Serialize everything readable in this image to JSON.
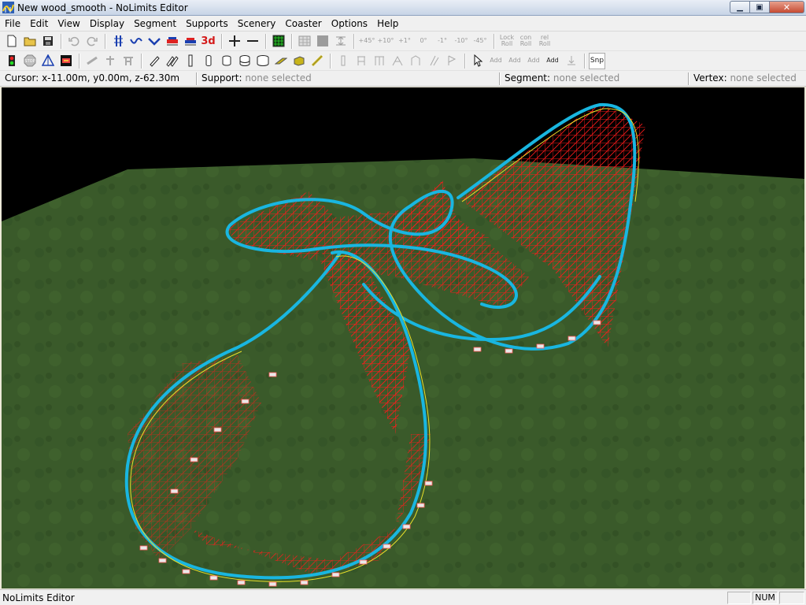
{
  "window": {
    "title": "New wood_smooth - NoLimits Editor",
    "min_glyph": "▁",
    "max_glyph": "▣",
    "close_glyph": "✕"
  },
  "menu": [
    "File",
    "Edit",
    "View",
    "Display",
    "Segment",
    "Supports",
    "Scenery",
    "Coaster",
    "Options",
    "Help"
  ],
  "toolbar1": {
    "icons": [
      "new-file-icon",
      "open-folder-icon",
      "save-disk-icon",
      "undo-icon",
      "redo-icon",
      "track-grid-icon",
      "segment-curve-icon",
      "segment-bend-icon",
      "train-icon",
      "train-alt-icon",
      "view-3d-icon",
      "zoom-in-icon",
      "zoom-out-icon",
      "terrain-map-icon",
      "grid-view-icon",
      "solid-view-icon",
      "align-icon"
    ],
    "text_3d": "3d",
    "roll_buttons": [
      "+45°",
      "+10°",
      "+1°",
      "0°",
      "-1°",
      "-10°",
      "-45°"
    ],
    "lock_roll": [
      "Lock",
      "Roll"
    ],
    "con_roll": [
      "con",
      "Roll"
    ],
    "rel_roll": [
      "rel",
      "Roll"
    ]
  },
  "toolbar2": {
    "icons": [
      "signal-light-icon",
      "stop-sign-icon",
      "station-icon",
      "block-brake-icon",
      "support-beam-icon",
      "support-post-icon",
      "support-tower-icon",
      "pencil-icon",
      "double-pencil-icon",
      "rail-piece-icon",
      "cylinder-1-icon",
      "cylinder-2-icon",
      "cylinder-3-icon",
      "cylinder-4-icon",
      "plank-icon",
      "box-icon",
      "ruler-icon",
      "footer-1-icon",
      "footer-2-icon",
      "footer-3-icon",
      "footer-4-icon",
      "footer-5-icon",
      "footer-6-icon",
      "footer-7-icon",
      "select-arrow-icon"
    ],
    "add_buttons": [
      "Add",
      "Add",
      "Add",
      "Add"
    ],
    "snap_label": "Snp"
  },
  "info": {
    "cursor_label": "Cursor:",
    "cursor_value": "x-11.00m, y0.00m, z-62.30m",
    "support_label": "Support:",
    "support_value": "none selected",
    "segment_label": "Segment:",
    "segment_value": "none selected",
    "vertex_label": "Vertex:",
    "vertex_value": "none selected"
  },
  "viewport": {
    "sky_color": "#000000",
    "ground_color": "#3a5a2a",
    "track_color": "#19b6e0",
    "support_color": "#ff1a1a"
  },
  "status": {
    "message": "NoLimits Editor",
    "num": "NUM"
  }
}
